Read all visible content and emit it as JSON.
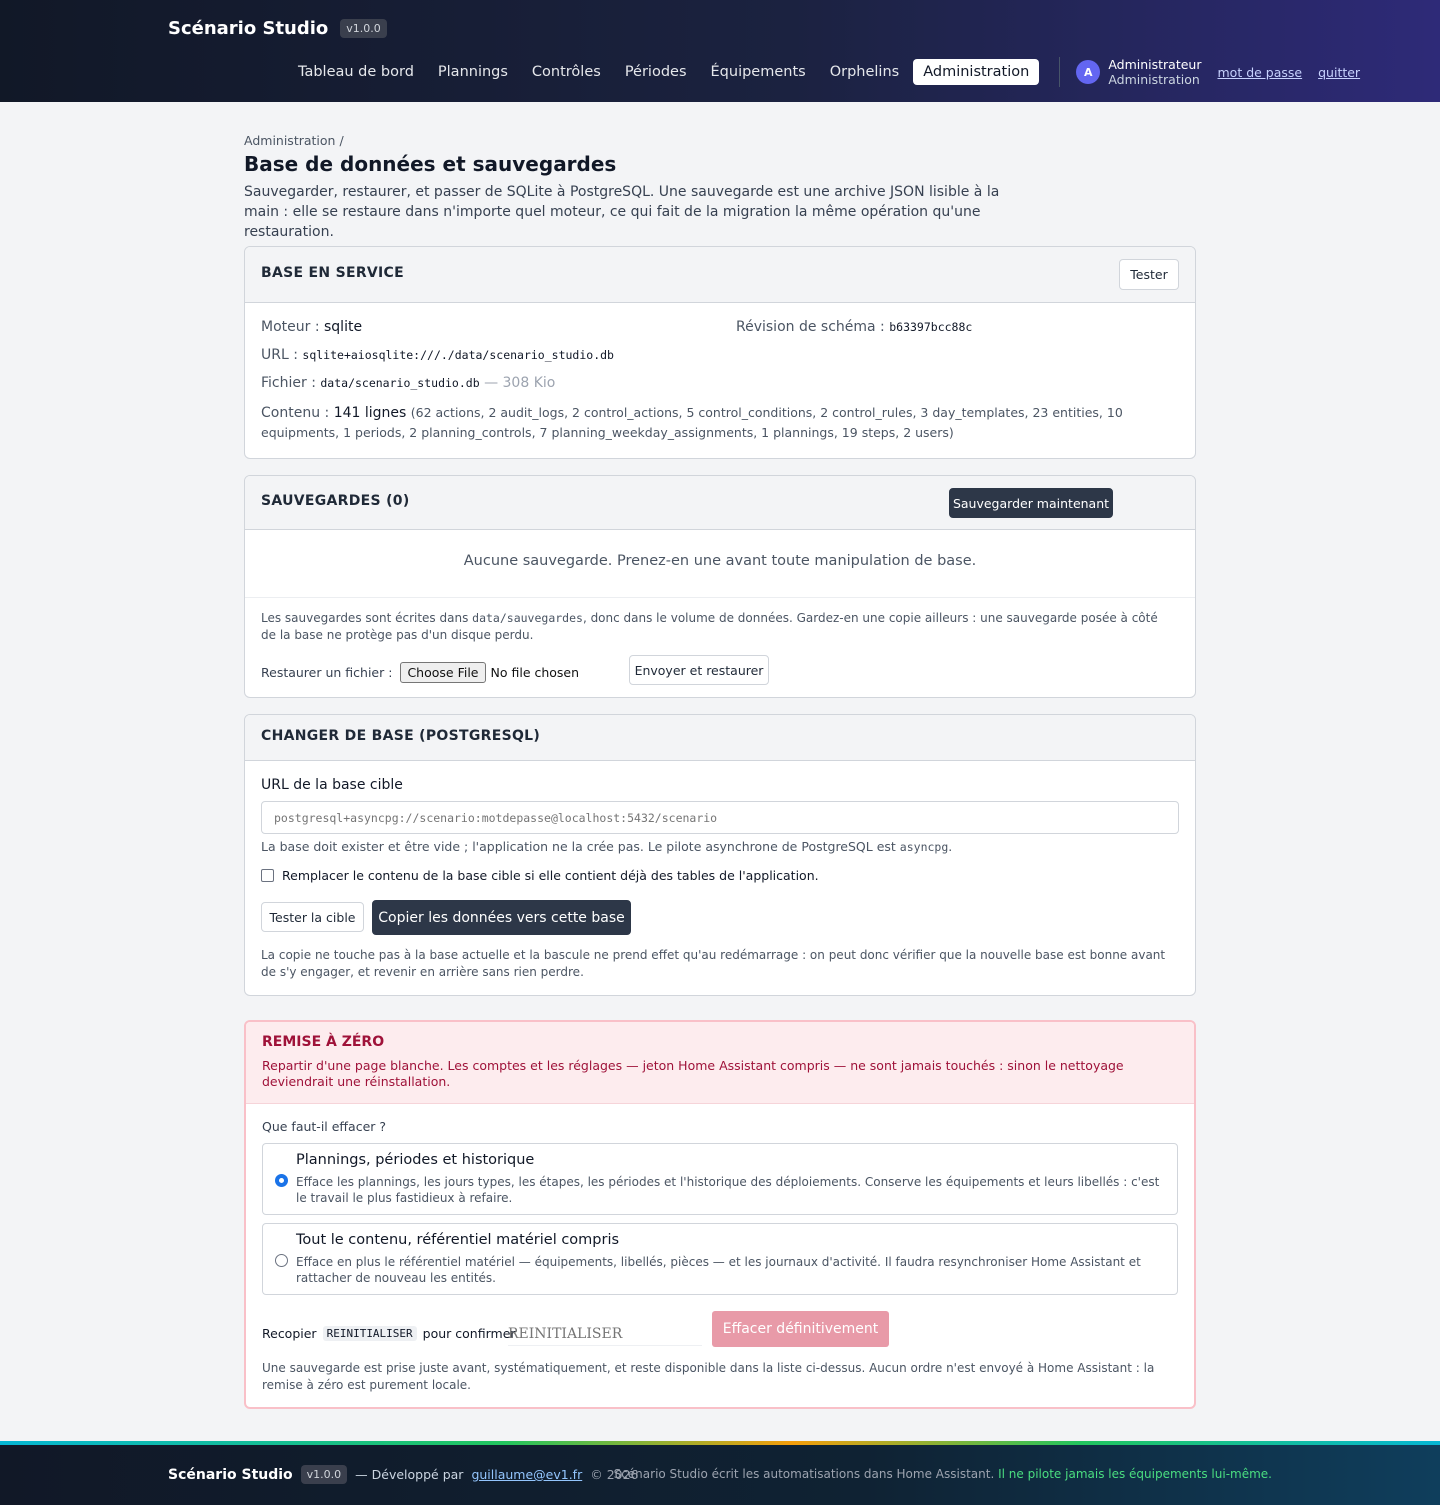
{
  "header": {
    "brand": "Scénario Studio",
    "version": "v1.0.0",
    "nav": [
      "Tableau de bord",
      "Plannings",
      "Contrôles",
      "Périodes",
      "Équipements",
      "Orphelins",
      "Administration"
    ],
    "active_nav": "Administration",
    "user": {
      "initial": "A",
      "name": "Administrateur",
      "role": "Administration"
    },
    "links": {
      "password": "mot de passe",
      "quit": "quitter"
    }
  },
  "page": {
    "breadcrumb": "Administration /",
    "title": "Base de données et sauvegardes",
    "lead": "Sauvegarder, restaurer, et passer de SQLite à PostgreSQL. Une sauvegarde est une archive JSON lisible à la main : elle se restaure dans n'importe quel moteur, ce qui fait de la migration la même opération qu'une restauration."
  },
  "db_card": {
    "title": "BASE EN SERVICE",
    "test_button": "Tester",
    "engine_label": "Moteur :",
    "engine": "sqlite",
    "schema_label": "Révision de schéma :",
    "schema": "b63397bcc88c",
    "url_label": "URL :",
    "url": "sqlite+aiosqlite:///./data/scenario_studio.db",
    "file_label": "Fichier :",
    "file": "data/scenario_studio.db",
    "file_size": "— 308 Kio",
    "content_label": "Contenu :",
    "content_rows": "141 lignes",
    "content_detail": "(62 actions, 2 audit_logs, 2 control_actions, 5 control_conditions, 2 control_rules, 3 day_templates, 23 entities, 10 equipments, 1 periods, 2 planning_controls, 7 planning_weekday_assignments, 1 plannings, 19 steps, 2 users)"
  },
  "backups": {
    "title": "SAUVEGARDES (0)",
    "save_button": "Sauvegarder maintenant",
    "empty": "Aucune sauvegarde. Prenez-en une avant toute manipulation de base.",
    "note_pre": "Les sauvegardes sont écrites dans ",
    "note_path": "data/sauvegardes",
    "note_post": ", donc dans le volume de données. Gardez-en une copie ailleurs : une sauvegarde posée à côté de la base ne protège pas d'un disque perdu.",
    "restore_label": "Restaurer un fichier :",
    "choose_file": "Choose File",
    "no_file": "No file chosen",
    "upload_button": "Envoyer et restaurer"
  },
  "migrate": {
    "title": "CHANGER DE BASE (POSTGRESQL)",
    "url_label": "URL de la base cible",
    "url_placeholder": "postgresql+asyncpg://scenario:motdepasse@localhost:5432/scenario",
    "hint_pre": "La base doit exister et être vide ; l'application ne la crée pas. Le pilote asynchrone de PostgreSQL est ",
    "hint_driver": "asyncpg",
    "hint_post": ".",
    "replace_label": "Remplacer le contenu de la base cible si elle contient déjà des tables de l'application.",
    "replace_checked": false,
    "test_button": "Tester la cible",
    "copy_button": "Copier les données vers cette base",
    "footnote": "La copie ne touche pas à la base actuelle et la bascule ne prend effet qu'au redémarrage : on peut donc vérifier que la nouvelle base est bonne avant de s'y engager, et revenir en arrière sans rien perdre."
  },
  "reset": {
    "title": "REMISE À ZÉRO",
    "text": "Repartir d'une page blanche. Les comptes et les réglages — jeton Home Assistant compris — ne sont jamais touchés : sinon le nettoyage deviendrait une réinstallation.",
    "question": "Que faut-il effacer ?",
    "options": [
      {
        "title": "Plannings, périodes et historique",
        "desc": "Efface les plannings, les jours types, les étapes, les périodes et l'historique des déploiements. Conserve les équipements et leurs libellés : c'est le travail le plus fastidieux à refaire.",
        "selected": true
      },
      {
        "title": "Tout le contenu, référentiel matériel compris",
        "desc": "Efface en plus le référentiel matériel — équipements, libellés, pièces — et les journaux d'activité. Il faudra resynchroniser Home Assistant et rattacher de nouveau les entités.",
        "selected": false
      }
    ],
    "confirm_pre": "Recopier",
    "confirm_code": "REINITIALISER",
    "confirm_post": "pour confirmer",
    "confirm_placeholder": "REINITIALISER",
    "erase_button": "Effacer définitivement",
    "footnote": "Une sauvegarde est prise juste avant, systématiquement, et reste disponible dans la liste ci-dessus. Aucun ordre n'est envoyé à Home Assistant : la remise à zéro est purement locale."
  },
  "footer": {
    "brand": "Scénario Studio",
    "version": "v1.0.0",
    "dev_pre": "— Développé par",
    "dev_email": "guillaume@ev1.fr",
    "copyright": "© 2026",
    "tagline": "Scénario Studio écrit les automatisations dans Home Assistant.",
    "tagline_accent": "Il ne pilote jamais les équipements lui-même."
  },
  "colors": {
    "accent": "#2d3748",
    "danger": "#9f1239",
    "danger_button": "#e89aa8",
    "link": "#c7d2fe",
    "footer_accent": "#4ade80"
  }
}
